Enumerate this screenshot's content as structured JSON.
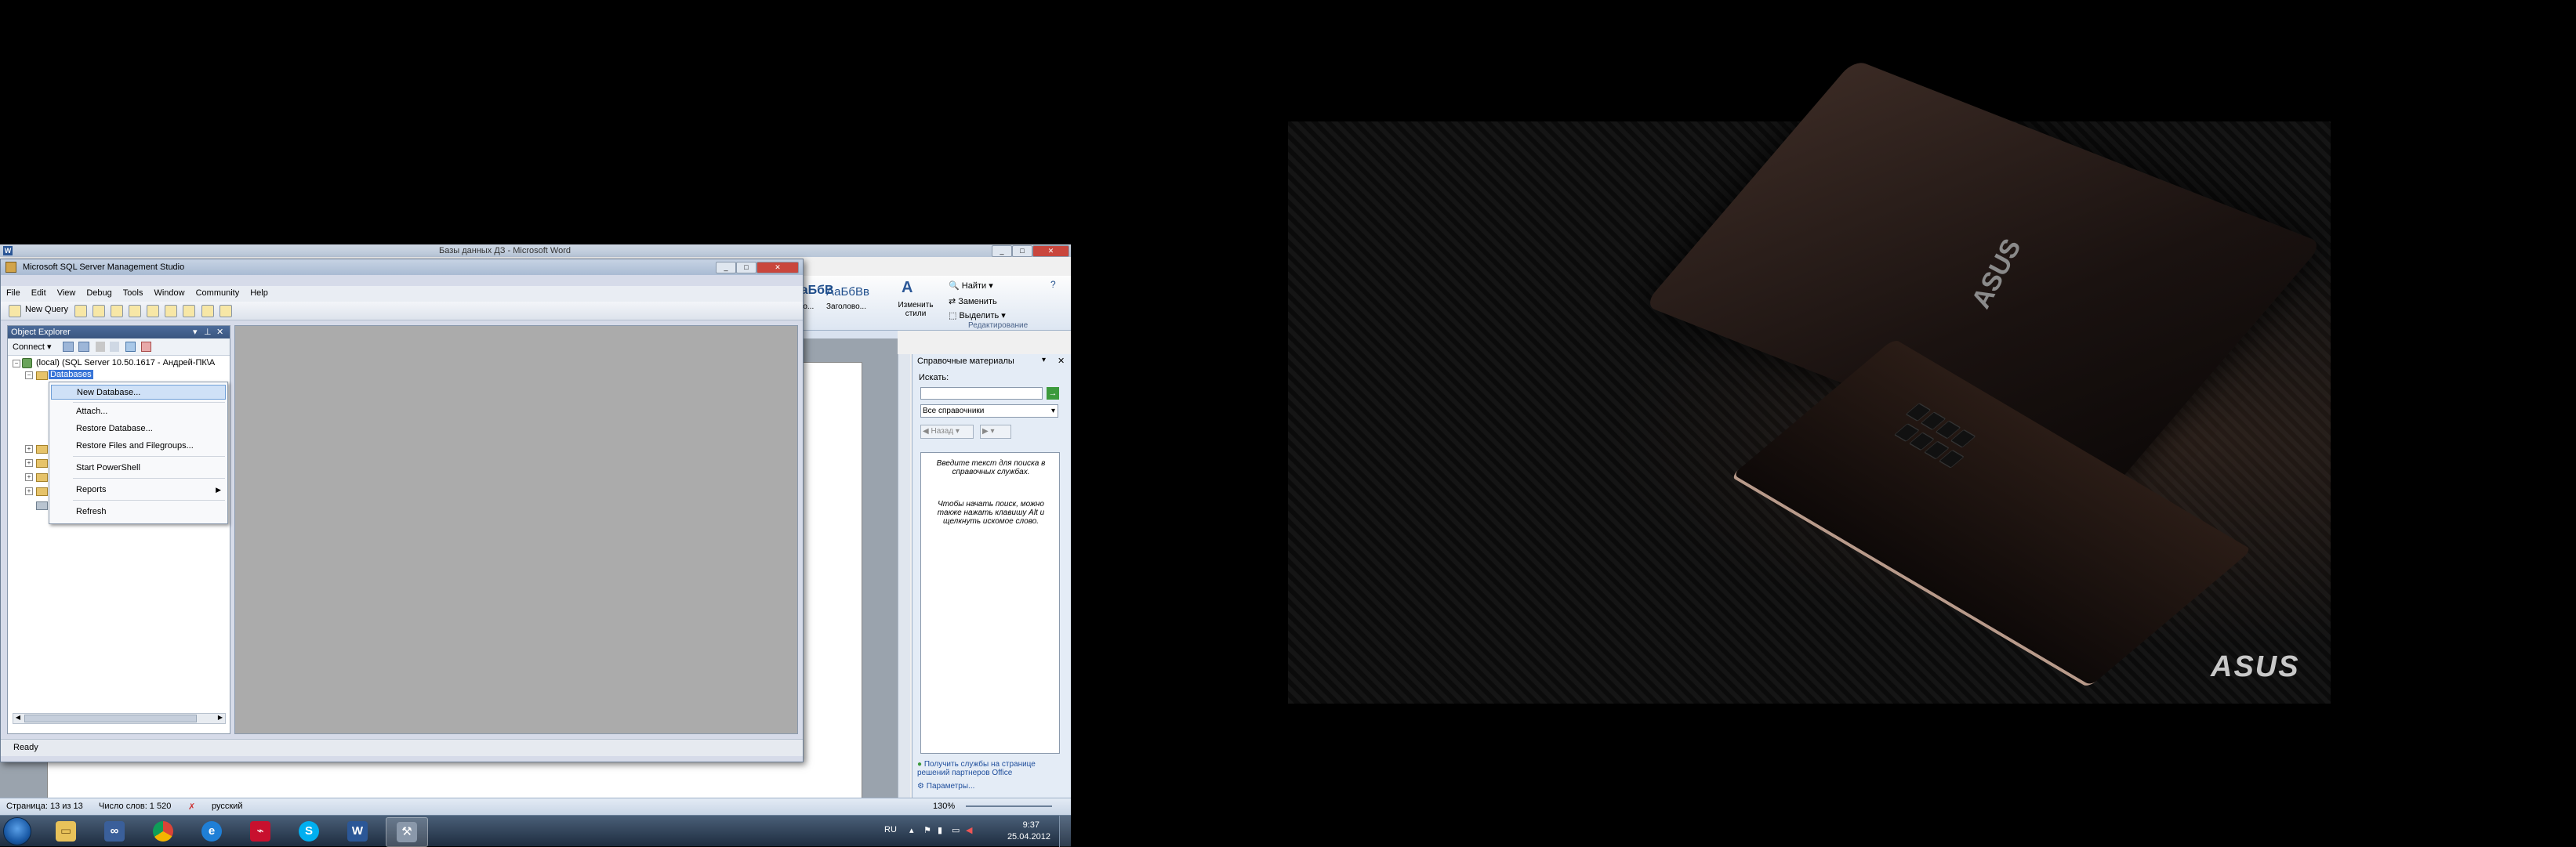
{
  "word": {
    "title": "Базы данных ДЗ - Microsoft Word",
    "ribbon": {
      "style_preview_1": "АаБбВ",
      "style_preview_2": "АаБбВв",
      "style_caption_1": "...о...",
      "style_caption_2": "Заголово...",
      "change_styles_label": "Изменить стили",
      "find_label": "Найти",
      "replace_label": "Заменить",
      "select_label": "Выделить",
      "editing_group_label": "Редактирование"
    },
    "help_pane": {
      "title": "Справочные материалы",
      "search_label": "Искать:",
      "search_value": "",
      "scope_select": "Все справочники",
      "back_label": "Назад",
      "hint_1": "Введите текст для поиска в справочных службах.",
      "hint_2": "Чтобы начать поиск, можно также нажать клавишу Alt и щелкнуть искомое слово.",
      "footer_link_1": "Получить службы на странице решений партнеров Office",
      "footer_link_2": "Параметры..."
    },
    "statusbar": {
      "page": "Страница: 13 из 13",
      "words": "Число слов: 1 520",
      "language": "русский",
      "zoom": "130%"
    }
  },
  "ssms": {
    "title": "Microsoft SQL Server Management Studio",
    "menu": [
      "File",
      "Edit",
      "View",
      "Debug",
      "Tools",
      "Window",
      "Community",
      "Help"
    ],
    "toolbar": {
      "new_query_label": "New Query"
    },
    "object_explorer": {
      "title": "Object Explorer",
      "connect_label": "Connect",
      "server_node": "(local) (SQL Server 10.50.1617 - Андрей-ПК\\А",
      "selected_node": "Databases"
    },
    "context_menu": {
      "items": [
        {
          "label": "New Database...",
          "highlighted": true
        },
        {
          "label": "Attach..."
        },
        {
          "label": "Restore Database..."
        },
        {
          "label": "Restore Files and Filegroups..."
        },
        {
          "label": "Start PowerShell"
        },
        {
          "label": "Reports",
          "submenu": true
        },
        {
          "label": "Refresh"
        }
      ]
    },
    "status": "Ready"
  },
  "taskbar": {
    "apps": [
      {
        "name": "explorer",
        "icon": "folder-icon"
      },
      {
        "name": "app-3",
        "icon": "glasses-icon"
      },
      {
        "name": "chrome",
        "icon": "chrome-icon"
      },
      {
        "name": "ie",
        "icon": "ie-icon",
        "glyph": "e"
      },
      {
        "name": "acrobat",
        "icon": "acrobat-icon"
      },
      {
        "name": "skype",
        "icon": "skype-icon",
        "glyph": "S"
      },
      {
        "name": "word",
        "icon": "word-icon",
        "glyph": "W"
      },
      {
        "name": "ssms",
        "icon": "ssms-icon"
      }
    ],
    "language": "RU",
    "time": "9:37",
    "date": "25.04.2012"
  },
  "wallpaper": {
    "brand": "ASUS"
  },
  "colors": {
    "taskbar": "#1e2d40",
    "selection": "#cfe1f7",
    "doc_gray": "#ababab"
  }
}
